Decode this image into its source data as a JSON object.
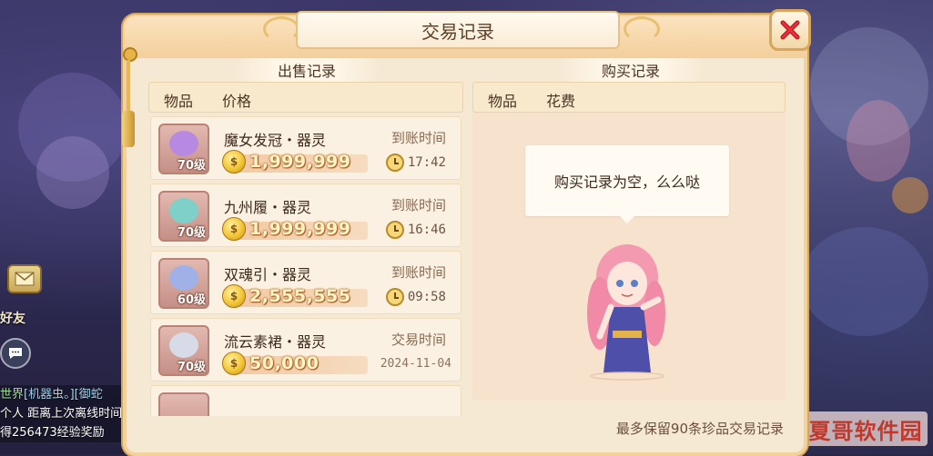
{
  "panel": {
    "title": "交易记录",
    "close_icon": "close-x-icon"
  },
  "sale_section": {
    "label": "出售记录",
    "header": {
      "item": "物品",
      "price": "价格"
    },
    "rows": [
      {
        "name": "魔女发冠・器灵",
        "level": "70级",
        "price": "1,999,999",
        "time_label": "到账时间",
        "time": "17:42",
        "time_kind": "clock",
        "orb": "#b889e0"
      },
      {
        "name": "九州履・器灵",
        "level": "70级",
        "price": "1,999,999",
        "time_label": "到账时间",
        "time": "16:46",
        "time_kind": "clock",
        "orb": "#7fd0c8"
      },
      {
        "name": "双魂引・器灵",
        "level": "60级",
        "price": "2,555,555",
        "time_label": "到账时间",
        "time": "09:58",
        "time_kind": "clock",
        "orb": "#9fb1e6"
      },
      {
        "name": "流云素裙・器灵",
        "level": "70级",
        "price": "50,000",
        "time_label": "交易时间",
        "time": "2024-11-04",
        "time_kind": "date",
        "orb": "#d7dbe8"
      }
    ]
  },
  "buy_section": {
    "label": "购买记录",
    "header": {
      "item": "物品",
      "cost": "花费"
    },
    "empty_text": "购买记录为空，么么哒"
  },
  "footer_note": "最多保留90条珍品交易记录",
  "hud": {
    "friend_label": "好友",
    "chat": [
      {
        "channel": "世界",
        "text": "[机器虫。][御蛇"
      },
      {
        "channel": "",
        "text": "个人 距离上次离线时间"
      },
      {
        "channel": "",
        "text": "得256473经验奖励"
      }
    ]
  },
  "watermark": "夏哥软件园",
  "colors": {
    "panel_bg": "#f6e9d4",
    "border": "#d6a55c",
    "price_text": "#fff4c4",
    "accent_red": "#c0392b"
  }
}
